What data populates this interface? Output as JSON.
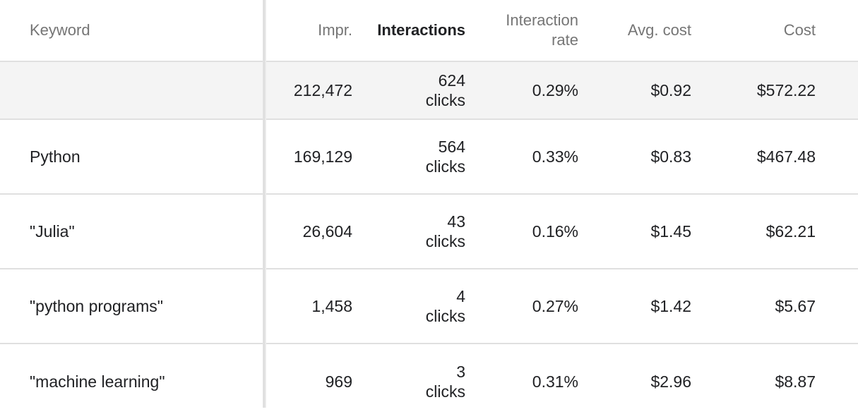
{
  "columns": {
    "keyword": "Keyword",
    "impr": "Impr.",
    "interactions": "Interactions",
    "rate_line1": "Interaction",
    "rate_line2": "rate",
    "avg_cost": "Avg. cost",
    "cost": "Cost"
  },
  "total": {
    "keyword": "",
    "impr": "212,472",
    "interactions_count": "624",
    "interactions_unit": "clicks",
    "rate": "0.29%",
    "avg_cost": "$0.92",
    "cost": "$572.22"
  },
  "rows": [
    {
      "keyword": "Python",
      "impr": "169,129",
      "interactions_count": "564",
      "interactions_unit": "clicks",
      "rate": "0.33%",
      "avg_cost": "$0.83",
      "cost": "$467.48"
    },
    {
      "keyword": "\"Julia\"",
      "impr": "26,604",
      "interactions_count": "43",
      "interactions_unit": "clicks",
      "rate": "0.16%",
      "avg_cost": "$1.45",
      "cost": "$62.21"
    },
    {
      "keyword": "\"python programs\"",
      "impr": "1,458",
      "interactions_count": "4",
      "interactions_unit": "clicks",
      "rate": "0.27%",
      "avg_cost": "$1.42",
      "cost": "$5.67"
    },
    {
      "keyword": "\"machine learning\"",
      "impr": "969",
      "interactions_count": "3",
      "interactions_unit": "clicks",
      "rate": "0.31%",
      "avg_cost": "$2.96",
      "cost": "$8.87"
    }
  ]
}
